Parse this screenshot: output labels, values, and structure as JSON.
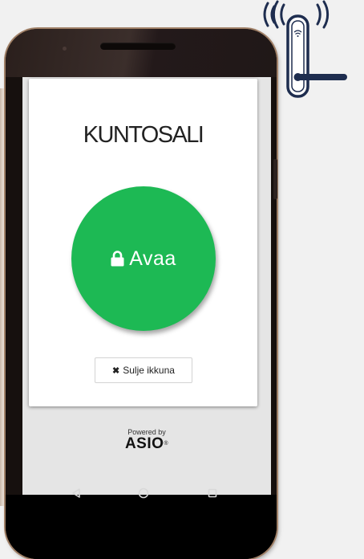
{
  "app": {
    "title": "KUNTOSALI",
    "open_button_label": "Avaa",
    "close_button_label": "Sulje ikkuna"
  },
  "branding": {
    "powered_by": "Powered by",
    "brand": "ASIO",
    "trademark": "®"
  },
  "icons": {
    "open": "lock-icon",
    "close": "x-icon",
    "illustration": "door-lock-wifi-icon",
    "nav": [
      "back-icon",
      "home-icon",
      "recents-icon"
    ]
  },
  "colors": {
    "accent_green": "#1db954",
    "lock_outline": "#1e2d4f"
  }
}
